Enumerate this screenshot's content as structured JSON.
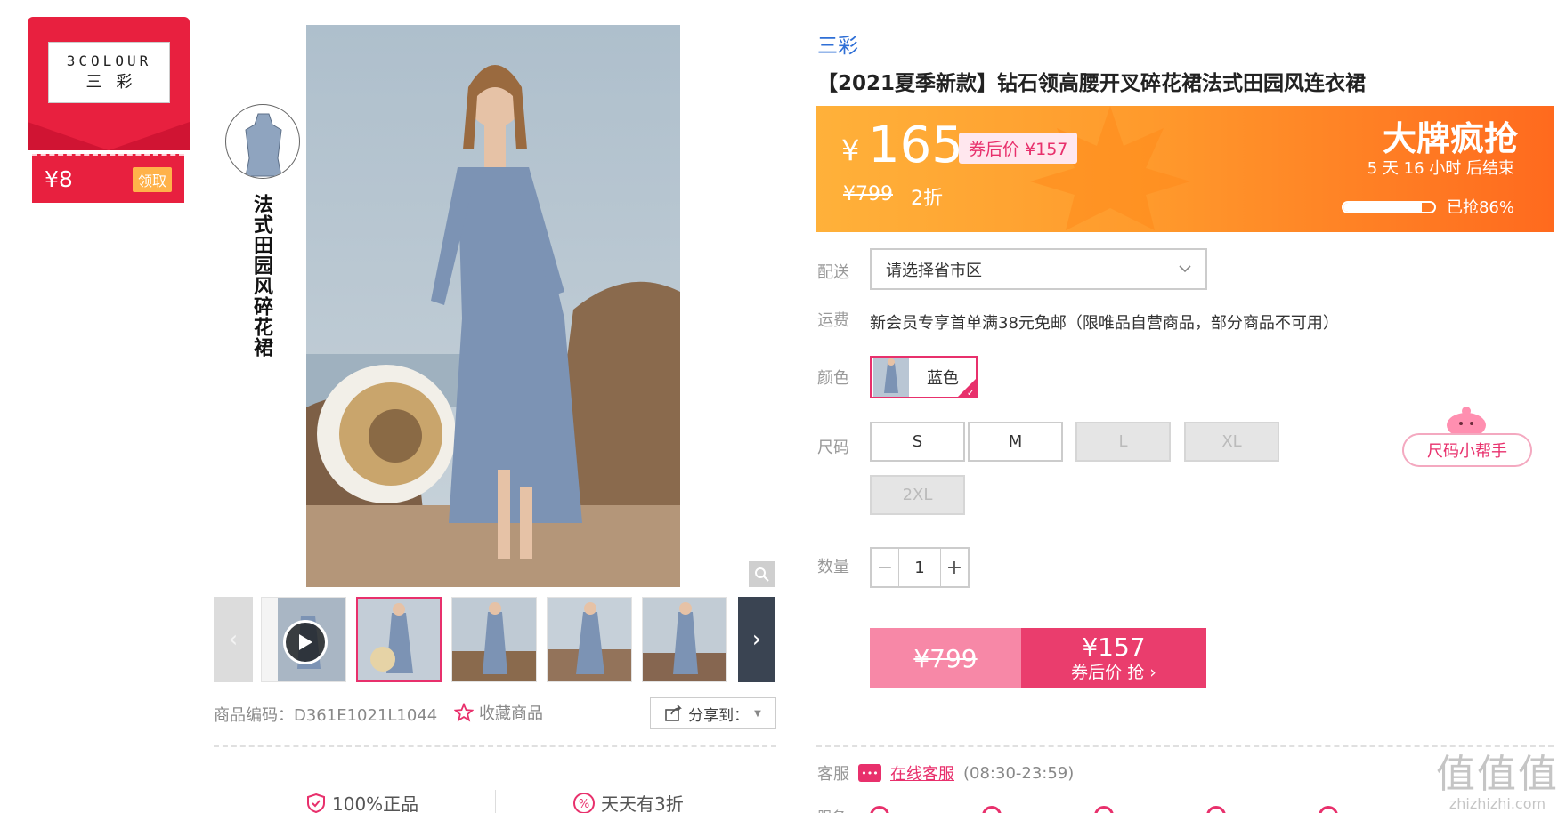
{
  "brand_card": {
    "logo_en": "3COLOUR",
    "logo_cn": "三彩",
    "coupon_amount": "¥8",
    "claim_label": "领取"
  },
  "side_caption": "法式田园风碎花裙",
  "gallery": {
    "thumbnails": [
      "video",
      "photo-1",
      "photo-2",
      "photo-3",
      "photo-4",
      "photo-5"
    ],
    "active_index": 1
  },
  "meta": {
    "product_code": "商品编码：D361E1021L1044",
    "favorite_label": "收藏商品",
    "share_label": "分享到："
  },
  "guarantees": {
    "authentic": "100%正品",
    "discount": "天天有3折"
  },
  "product": {
    "brand": "三彩",
    "title": "【2021夏季新款】钻石领高腰开叉碎花裙法式田园风连衣裙"
  },
  "promo": {
    "currency": "¥",
    "price": "165",
    "coupon_price": "券后价 ¥157",
    "original_price": "¥799",
    "discount": "2折",
    "flash_title": "大牌疯抢",
    "countdown": "5 天 16 小时 后结束",
    "sold_label": "已抢86%",
    "sold_fraction": 0.86
  },
  "options": {
    "shipping_label": "配送",
    "region_placeholder": "请选择省市区",
    "freight_label": "运费",
    "freight_text": "新会员专享首单满38元免邮（限唯品自营商品，部分商品不可用）",
    "color_label": "颜色",
    "color_value": "蓝色",
    "size_label": "尺码",
    "sizes": [
      {
        "label": "S",
        "available": true
      },
      {
        "label": "M",
        "available": true
      },
      {
        "label": "L",
        "available": false
      },
      {
        "label": "XL",
        "available": false
      },
      {
        "label": "2XL",
        "available": false
      }
    ],
    "size_helper": "尺码小帮手",
    "qty_label": "数量",
    "qty_value": "1",
    "qty_minus": "−",
    "qty_plus": "+"
  },
  "buy": {
    "original_price": "¥799",
    "coupon_price": "¥157",
    "cta": "券后价 抢 ›"
  },
  "service": {
    "label": "客服",
    "link": "在线客服",
    "hours": "(08:30-23:59)",
    "label2": "服务"
  },
  "watermark": {
    "big": "值值值",
    "small": "zhizhizhi.com"
  },
  "colors": {
    "accent": "#e8306c",
    "brand_red": "#e8203f",
    "promo_orange": "#ff7a22",
    "link_blue": "#2f6fd6"
  }
}
